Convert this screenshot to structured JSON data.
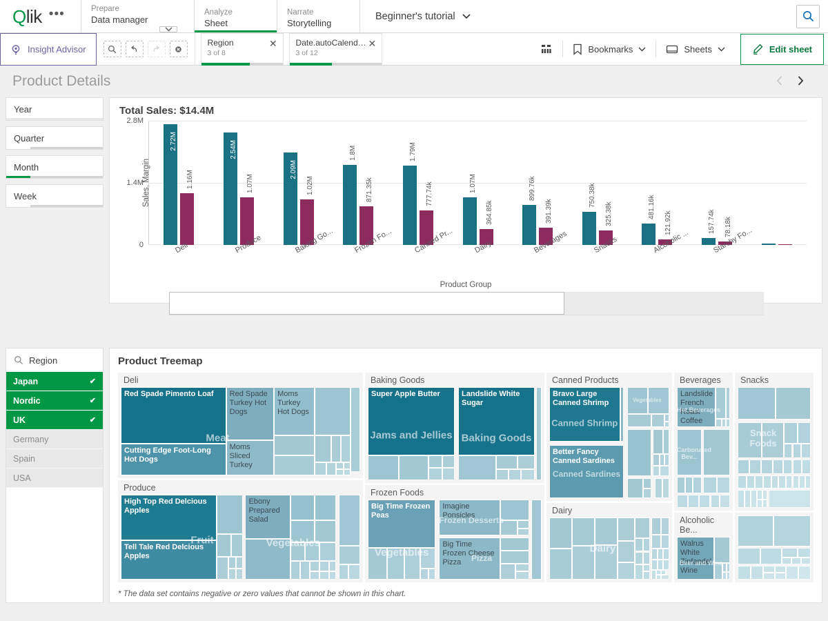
{
  "topbar": {
    "logo": "Qlik",
    "more_icon": "•••",
    "nav": [
      {
        "sub": "Prepare",
        "main": "Data manager",
        "active": false
      },
      {
        "sub": "Analyze",
        "main": "Sheet",
        "active": true
      },
      {
        "sub": "Narrate",
        "main": "Storytelling",
        "active": false
      }
    ],
    "app_title": "Beginner's tutorial",
    "app_caret": "⌄",
    "search_icon": "search-icon"
  },
  "selection_bar": {
    "insight_advisor": "Insight Advisor",
    "tools": [
      "selection-search-icon",
      "step-back-icon",
      "step-forward-icon",
      "clear-all-icon"
    ],
    "chips": [
      {
        "name": "Region",
        "count": "3 of 8",
        "fill_pct": 60
      },
      {
        "name": "Date.autoCalendar....",
        "count": "3 of 12",
        "fill_pct": 46
      }
    ],
    "buttons": [
      {
        "label": "Bookmarks",
        "icon": "bookmark-icon",
        "caret": "⌄"
      },
      {
        "label": "Sheets",
        "icon": "sheet-icon",
        "caret": "⌄"
      }
    ],
    "edit_sheet": "Edit sheet",
    "grid_icon": "grid-view-icon"
  },
  "sheet": {
    "title": "Product Details",
    "prev_icon": "‹",
    "next_icon": "›"
  },
  "filters": [
    {
      "label": "Year",
      "fill_pct": 0,
      "color": "#009845"
    },
    {
      "label": "Quarter",
      "fill_pct": 25,
      "color": "#ffffff"
    },
    {
      "label": "Month",
      "fill_pct": 25,
      "color": "#009845"
    },
    {
      "label": "Week",
      "fill_pct": 25,
      "color": "#ffffff"
    }
  ],
  "bar_chart": {
    "title": "Total Sales: $14.4M",
    "xaxis_title": "Product Group",
    "footer_scroll_pct": 66.5
  },
  "chart_data": {
    "type": "bar",
    "title": "Total Sales: $14.4M",
    "xlabel": "Product Group",
    "ylabel": "Sales, Margin",
    "ylim": [
      0,
      2800000
    ],
    "yticks": [
      "0",
      "1.4M",
      "2.8M"
    ],
    "grid": true,
    "legend": "none",
    "categories": [
      "Deli",
      "Produce",
      "Baking Go...",
      "Frozen Fo...",
      "Canned Pr...",
      "Dairy",
      "Beverages",
      "Snacks",
      "Alcoholic ...",
      "Starchy Fo...",
      ""
    ],
    "series": [
      {
        "name": "Sales",
        "color": "#1a7183",
        "values": [
          2720000,
          2540000,
          2090000,
          1800000,
          1790000,
          1070000,
          899760,
          750380,
          481160,
          157740,
          30000
        ],
        "labels": [
          "2.72M",
          "2.54M",
          "2.09M",
          "1.8M",
          "1.79M",
          "1.07M",
          "899.76k",
          "750.38k",
          "481.16k",
          "157.74k",
          ""
        ]
      },
      {
        "name": "Margin",
        "color": "#8e2b5e",
        "values": [
          1160000,
          1070000,
          1020000,
          871350,
          777740,
          364850,
          391390,
          325380,
          121920,
          78180,
          9000
        ],
        "labels": [
          "1.16M",
          "1.07M",
          "1.02M",
          "871.35k",
          "777.74k",
          "364.85k",
          "391.39k",
          "325.38k",
          "121.92k",
          "78.18k",
          ""
        ]
      }
    ]
  },
  "region_filter": {
    "title": "Region",
    "search_icon": "search-icon",
    "check_icon": "✔",
    "items": [
      {
        "label": "Japan",
        "state": "selected"
      },
      {
        "label": "Nordic",
        "state": "selected"
      },
      {
        "label": "UK",
        "state": "selected"
      },
      {
        "label": "Germany",
        "state": "alternative"
      },
      {
        "label": "Spain",
        "state": "alternative"
      },
      {
        "label": "USA",
        "state": "alternative"
      }
    ]
  },
  "treemap": {
    "title": "Product Treemap",
    "footnote": "* The data set contains negative or zero values that cannot be shown in this chart.",
    "groups": [
      {
        "name": "Deli",
        "group_label": "Meat",
        "tiles": [
          "Red Spade Pimento Loaf",
          "Cutting Edge Foot-Long Hot Dogs",
          "Red Spade Turkey Hot Dogs",
          "Moms Sliced Turkey",
          "Moms Turkey Hot Dogs"
        ]
      },
      {
        "name": "Produce",
        "group_labels": [
          "Fruit",
          "Vegetables"
        ],
        "tiles": [
          "High Top Red Delcious Apples",
          "Tell Tale Red Delcious Apples",
          "Ebony Prepared Salad"
        ]
      },
      {
        "name": "Baking Goods",
        "group_labels": [
          "Jams and Jellies",
          "Baking Goods"
        ],
        "tiles": [
          "Super Apple Butter",
          "Landslide White Sugar"
        ]
      },
      {
        "name": "Frozen Foods",
        "group_labels": [
          "Vegetables",
          "Frozen Desserts",
          "Pizza"
        ],
        "tiles": [
          "Big Time Frozen Peas",
          "Imagine Ponsicles",
          "Big Time Frozen Cheese Pizza"
        ]
      },
      {
        "name": "Canned Products",
        "group_labels": [
          "Canned Shrimp",
          "Canned Sardines",
          "Vegetables"
        ],
        "tiles": [
          "Bravo Large Canned Shrimp",
          "Better Fancy Canned Sardines"
        ]
      },
      {
        "name": "Dairy",
        "group_label": "Dairy",
        "tiles": []
      },
      {
        "name": "Beverages",
        "group_labels": [
          "Hot Beverages",
          "Carbonated Bev..."
        ],
        "tiles": [
          "Landslide French Roast Coffee"
        ]
      },
      {
        "name": "Snacks",
        "group_label": "Snack Foods",
        "tiles": []
      },
      {
        "name": "Alcoholic Be...",
        "group_label": "Beer and Wine",
        "tiles": [
          "Walrus White Zinfandel Wine"
        ]
      }
    ]
  },
  "colors": {
    "brand_green": "#009845",
    "sales_teal": "#1a7183",
    "margin_magenta": "#8e2b5e",
    "insight_purple": "#6e5fa8",
    "treemap_dark": "#16718a",
    "treemap_mid": "#6fa4b8",
    "treemap_light": "#b3cbd9"
  }
}
